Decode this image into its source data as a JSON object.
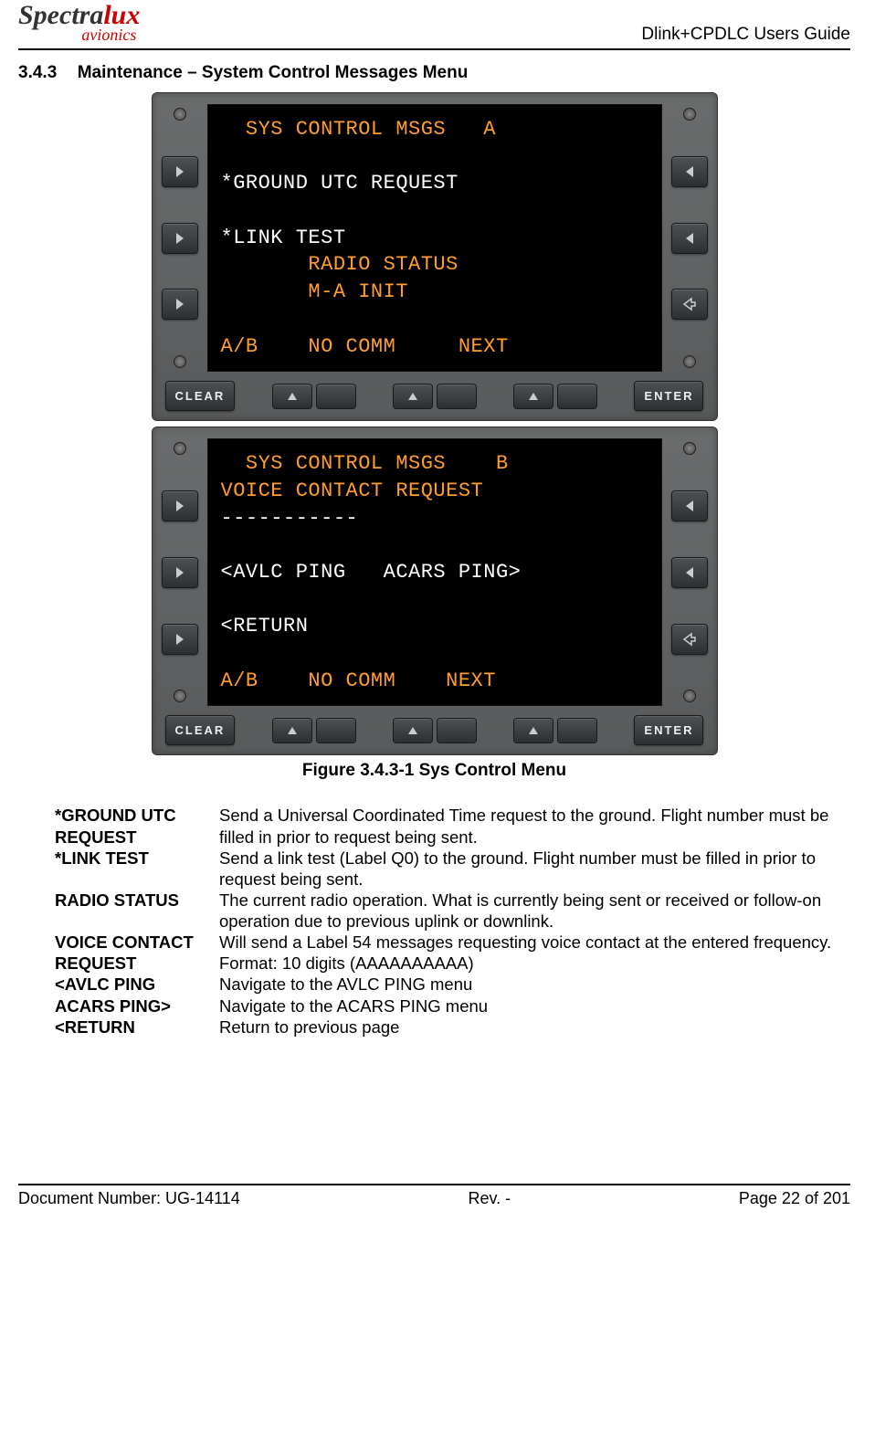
{
  "header": {
    "logo_black": "Spectra",
    "logo_red_lux": "lux",
    "logo_av": "avionics",
    "guide": "Dlink+CPDLC Users Guide"
  },
  "section": {
    "num": "3.4.3",
    "title": "Maintenance – System Control Messages Menu"
  },
  "screens": {
    "a": {
      "title": "  SYS CONTROL MSGS   A",
      "l1": "*GROUND UTC REQUEST",
      "l2": "*LINK TEST",
      "l3": "       RADIO STATUS",
      "l4": "       M-A INIT",
      "l5": "A/B    NO COMM     NEXT"
    },
    "b": {
      "title": "  SYS CONTROL MSGS    B",
      "l1": "VOICE CONTACT REQUEST",
      "l2": "-----------",
      "l3": "<AVLC PING   ACARS PING>",
      "l4": "<RETURN",
      "l5": "A/B    NO COMM    NEXT"
    }
  },
  "buttons": {
    "clear": "CLEAR",
    "enter": "ENTER"
  },
  "caption": "Figure 3.4.3-1 Sys Control Menu",
  "desc": [
    {
      "term": "*GROUND UTC REQUEST",
      "def": "Send a Universal Coordinated Time request to the ground. Flight number must be filled in prior to request being sent."
    },
    {
      "term": "*LINK TEST",
      "def": "Send a link test (Label Q0) to the ground.\nFlight number must be filled in prior to request being sent."
    },
    {
      "term": "RADIO STATUS",
      "def": "The current radio operation.  What is currently being sent or received or follow-on operation due to previous uplink or downlink."
    },
    {
      "term": "VOICE CONTACT REQUEST",
      "def": "Will send a Label 54 messages requesting voice contact at the entered frequency.\nFormat: 10 digits (AAAAAAAAAA)"
    },
    {
      "term": "<AVLC PING",
      "def": "Navigate to the AVLC PING menu"
    },
    {
      "term": "ACARS PING>",
      "def": "Navigate to the ACARS PING menu"
    },
    {
      "term": "<RETURN",
      "def": "Return to previous page"
    }
  ],
  "footer": {
    "docnum": "Document Number:  UG-14114",
    "rev": "Rev. -",
    "page": "Page 22 of 201"
  }
}
